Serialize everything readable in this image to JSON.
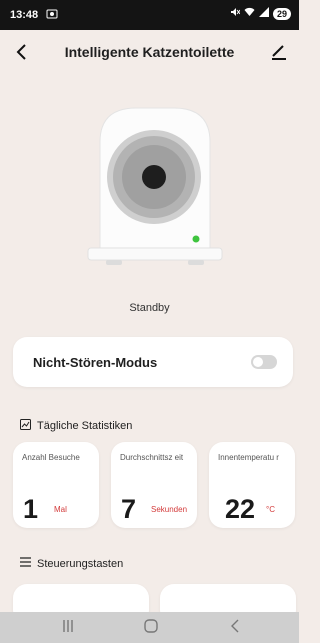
{
  "status_bar": {
    "time": "13:48",
    "system_icon": "screenshot-icon",
    "icons": [
      "mute-icon",
      "wifi-icon",
      "signal-icon"
    ],
    "battery": "29"
  },
  "header": {
    "title": "Intelligente Katzentoilette",
    "back_icon": "chevron-left-icon",
    "edit_icon": "edit-icon"
  },
  "device": {
    "status": "Standby",
    "indicator_color": "#3ec43e"
  },
  "dnd": {
    "label": "Nicht-Stören-Modus",
    "enabled": false
  },
  "daily_stats": {
    "title": "Tägliche Statistiken",
    "items": [
      {
        "label": "Anzahl Besuche",
        "value": "1",
        "unit": "Mal"
      },
      {
        "label": "Durchschnittsz eit",
        "value": "7",
        "unit": "Sekunden"
      },
      {
        "label": "Innentemperatu r",
        "value": "22",
        "unit": "°C"
      }
    ]
  },
  "controls": {
    "title": "Steuerungstasten"
  },
  "nav_bar": {
    "recent_icon": "recent-apps-icon",
    "home_icon": "home-icon",
    "back_icon": "back-icon"
  },
  "colors": {
    "background": "#f3ece8",
    "accent_red": "#d33b3b",
    "status_bar": "#141414"
  }
}
